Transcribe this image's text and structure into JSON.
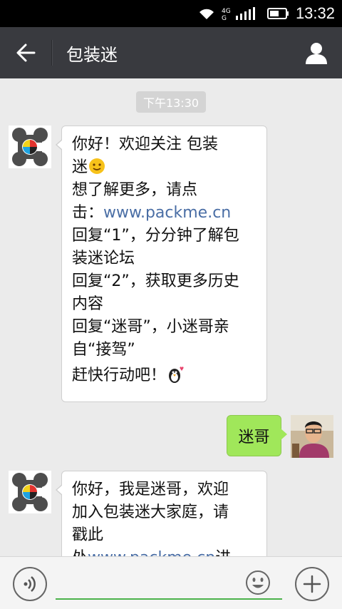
{
  "status_bar": {
    "network": "4G",
    "time": "13:32"
  },
  "header": {
    "title": "包装迷",
    "back_icon": "arrow-left-icon",
    "profile_icon": "person-icon"
  },
  "chat": {
    "timestamp": "下午13:30",
    "messages": [
      {
        "sender": "official",
        "lines": [
          "你好！欢迎关注 包装",
          "迷",
          "想了解更多，请点",
          "击：",
          "www.packme.cn",
          "回复“1”，分分钟了解包",
          "装迷论坛",
          "回复“2”，获取更多历史",
          "内容",
          "回复“迷哥”，小迷哥亲",
          "自“接驾”",
          "赶快行动吧！"
        ]
      },
      {
        "sender": "me",
        "text": "迷哥"
      },
      {
        "sender": "official",
        "lines": [
          "你好，我是迷哥，欢迎",
          "加入包装迷大家庭，请",
          "戳此",
          "处",
          "www.packme.cn",
          "进"
        ]
      }
    ]
  },
  "input_bar": {
    "voice_icon": "voice-icon",
    "emoji_icon": "emoji-icon",
    "plus_icon": "plus-icon",
    "placeholder": ""
  },
  "colors": {
    "titlebar": "#393a3f",
    "chat_bg": "#ebebeb",
    "my_bubble": "#a0e75a",
    "link": "#4a6ea5",
    "input_underline": "#4bb24b"
  }
}
